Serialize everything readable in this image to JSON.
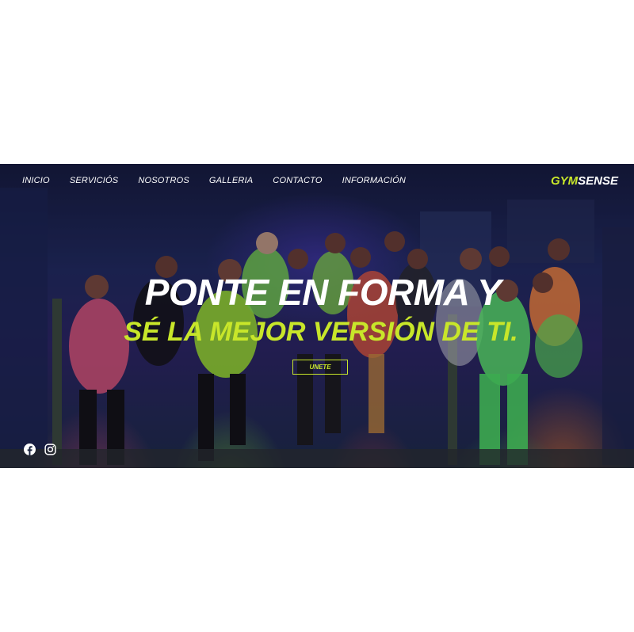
{
  "nav": {
    "items": [
      "INICIO",
      "SERVICIÓS",
      "NOSOTROS",
      "GALLERIA",
      "CONTACTO",
      "INFORMACIÓN"
    ]
  },
  "logo": {
    "part1": "GYM",
    "part2": "SENSE"
  },
  "hero": {
    "headline": "PONTE EN FORMA Y",
    "subheadline": "SÉ LA MEJOR VERSIÓN DE TI.",
    "cta_label": "UNETE"
  },
  "social": {
    "icons": [
      "facebook-icon",
      "instagram-icon"
    ]
  },
  "colors": {
    "accent": "#c8e62a",
    "text": "#ffffff"
  }
}
